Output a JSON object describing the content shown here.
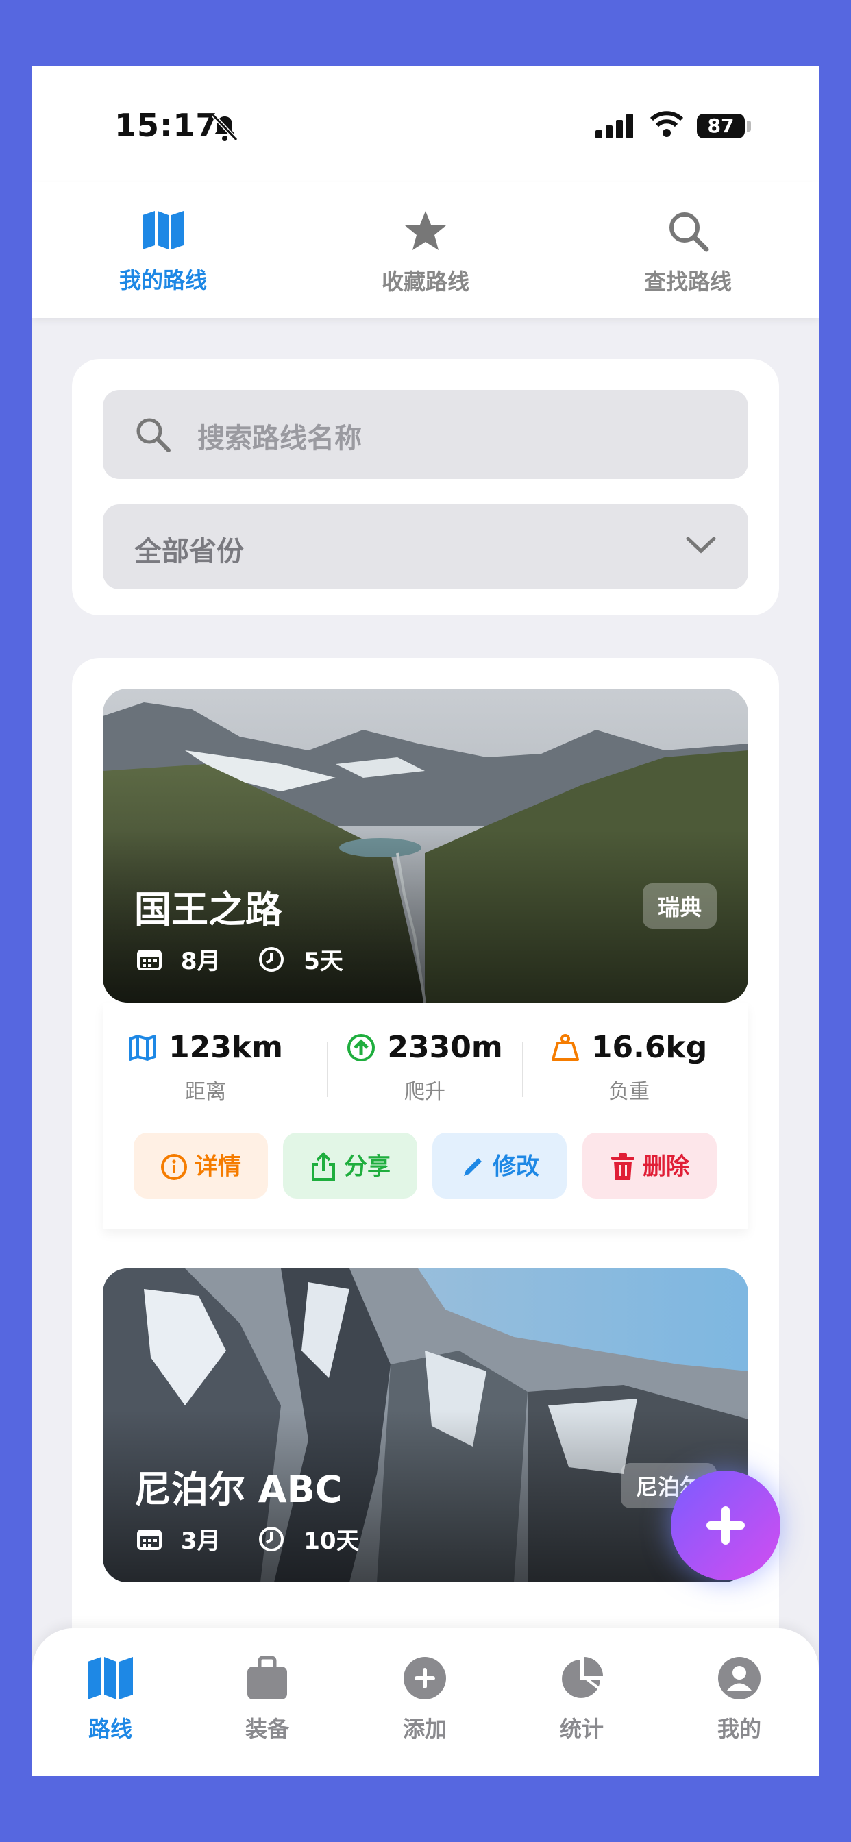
{
  "status": {
    "time": "15:17",
    "battery": "87"
  },
  "top_tabs": [
    {
      "label": "我的路线",
      "icon": "map-icon",
      "active": true
    },
    {
      "label": "收藏路线",
      "icon": "star-icon",
      "active": false
    },
    {
      "label": "查找路线",
      "icon": "search-icon",
      "active": false
    }
  ],
  "search": {
    "placeholder": "搜索路线名称"
  },
  "province_select": {
    "value": "全部省份"
  },
  "routes": [
    {
      "name": "国王之路",
      "country": "瑞典",
      "month": "8月",
      "days": "5天",
      "distance": "123km",
      "distance_label": "距离",
      "climb": "2330m",
      "climb_label": "爬升",
      "load": "16.6kg",
      "load_label": "负重"
    },
    {
      "name": "尼泊尔 ABC",
      "country": "尼泊尔",
      "month": "3月",
      "days": "10天"
    }
  ],
  "actions": {
    "detail": "详情",
    "share": "分享",
    "edit": "修改",
    "delete": "删除"
  },
  "bottom_nav": [
    {
      "label": "路线",
      "icon": "map-icon",
      "active": true
    },
    {
      "label": "装备",
      "icon": "bag-icon",
      "active": false
    },
    {
      "label": "添加",
      "icon": "plus-circle-icon",
      "active": false
    },
    {
      "label": "统计",
      "icon": "pie-chart-icon",
      "active": false
    },
    {
      "label": "我的",
      "icon": "person-icon",
      "active": false
    }
  ],
  "colors": {
    "accent": "#1e88e5",
    "background": "#5667e0"
  }
}
